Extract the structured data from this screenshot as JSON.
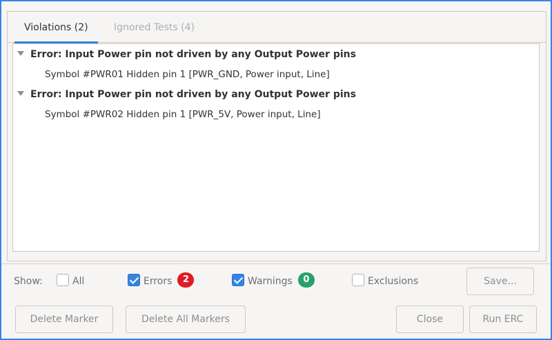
{
  "tabs": [
    {
      "label": "Violations (2)",
      "active": true
    },
    {
      "label": "Ignored Tests (4)",
      "active": false
    }
  ],
  "violations": [
    {
      "error": "Error: Input Power pin not driven by any Output Power pins",
      "detail": "Symbol #PWR01 Hidden pin 1 [PWR_GND, Power input, Line]"
    },
    {
      "error": "Error: Input Power pin not driven by any Output Power pins",
      "detail": "Symbol #PWR02 Hidden pin 1 [PWR_5V, Power input, Line]"
    }
  ],
  "filters": {
    "show_label": "Show:",
    "all": {
      "label": "All",
      "checked": false
    },
    "errors": {
      "label": "Errors",
      "checked": true,
      "count": "2",
      "color": "#e01b24"
    },
    "warnings": {
      "label": "Warnings",
      "checked": true,
      "count": "0",
      "color": "#26a269"
    },
    "exclusions": {
      "label": "Exclusions",
      "checked": false
    }
  },
  "buttons": {
    "save": "Save...",
    "delete_marker": "Delete Marker",
    "delete_all_markers": "Delete All Markers",
    "close": "Close",
    "run_erc": "Run ERC"
  },
  "colors": {
    "accent": "#3584e4"
  }
}
